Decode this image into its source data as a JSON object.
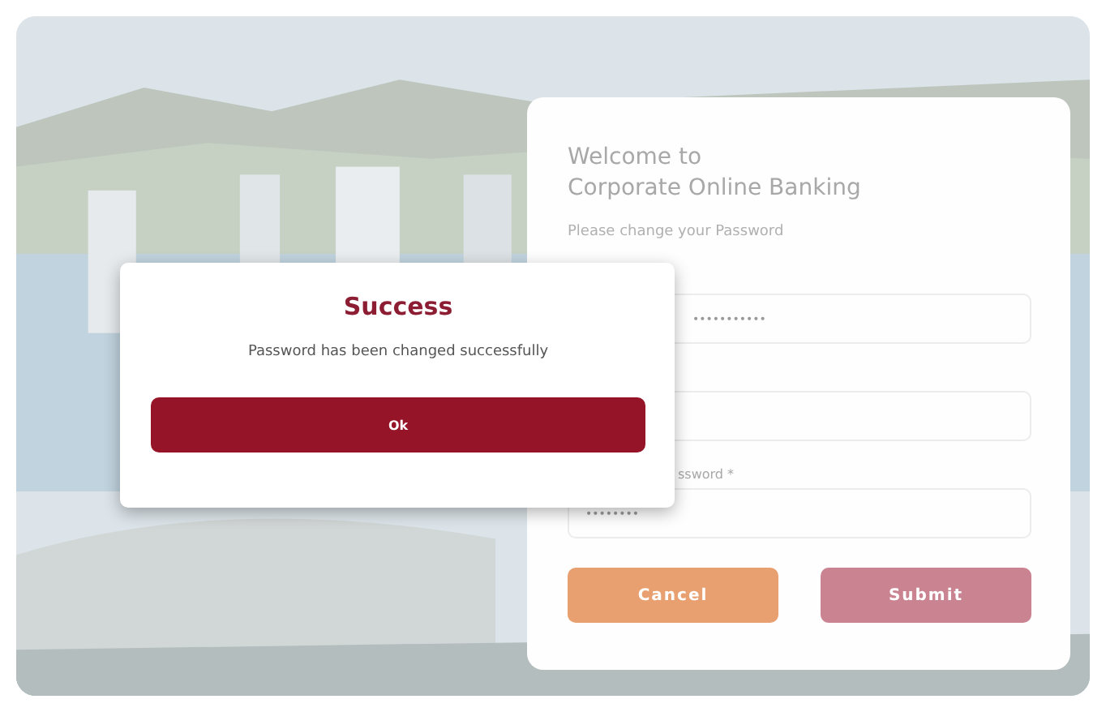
{
  "card": {
    "title_lines": [
      "Welcome to",
      "Corporate Online Banking"
    ],
    "subtitle": "Please change your Password",
    "fields": [
      {
        "kind": "filled",
        "value": "•••••••••••"
      },
      {
        "kind": "empty"
      },
      {
        "kind": "filled",
        "label": "ssword *",
        "value": "••••••••"
      }
    ],
    "buttons": [
      {
        "label": "Cancel",
        "kind": "secondary"
      },
      {
        "label": "Submit",
        "kind": "primary"
      }
    ]
  },
  "dialog": {
    "title": "Success",
    "message": "Password has been changed successfully",
    "button": "Ok"
  }
}
